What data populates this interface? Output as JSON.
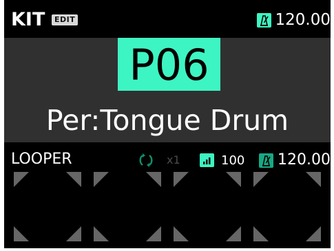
{
  "header": {
    "mode_label": "KIT",
    "edit_badge": "EDIT",
    "tempo": "120.00"
  },
  "patch": {
    "number": "P06",
    "name": "Per:Tongue Drum"
  },
  "looper": {
    "label": "LOOPER",
    "repeat_count": "x1",
    "volume": "100",
    "tempo": "120.00",
    "pads": [
      "pad-1",
      "pad-2",
      "pad-3",
      "pad-4"
    ]
  },
  "colors": {
    "accent": "#3df5c2",
    "accent_dim": "#17a884",
    "panel": "#303030",
    "background": "#000000",
    "pad_corner": "#666666"
  },
  "icons": {
    "metronome": "metronome-icon",
    "loop": "loop-icon",
    "volume": "volume-bars-icon"
  }
}
